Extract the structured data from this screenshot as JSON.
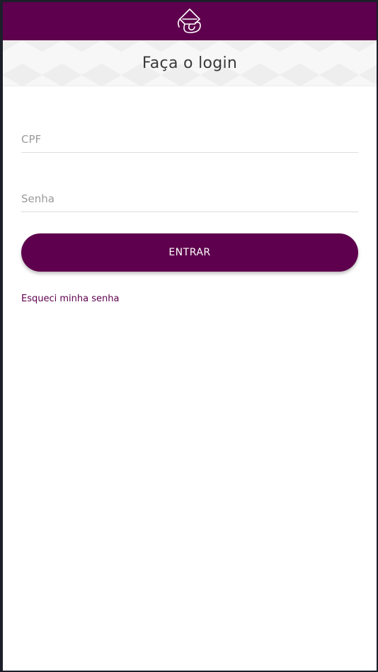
{
  "header": {
    "logo_icon": "brand-logo-icon",
    "background_color": "#5e004d"
  },
  "title_band": {
    "title": "Faça o login"
  },
  "form": {
    "cpf": {
      "placeholder": "CPF",
      "value": ""
    },
    "senha": {
      "placeholder": "Senha",
      "value": ""
    },
    "submit_label": "ENTRAR",
    "forgot_password_label": "Esqueci minha senha"
  },
  "colors": {
    "brand": "#5e004d",
    "text": "#3a3a3a",
    "placeholder": "#9a9a9a"
  }
}
